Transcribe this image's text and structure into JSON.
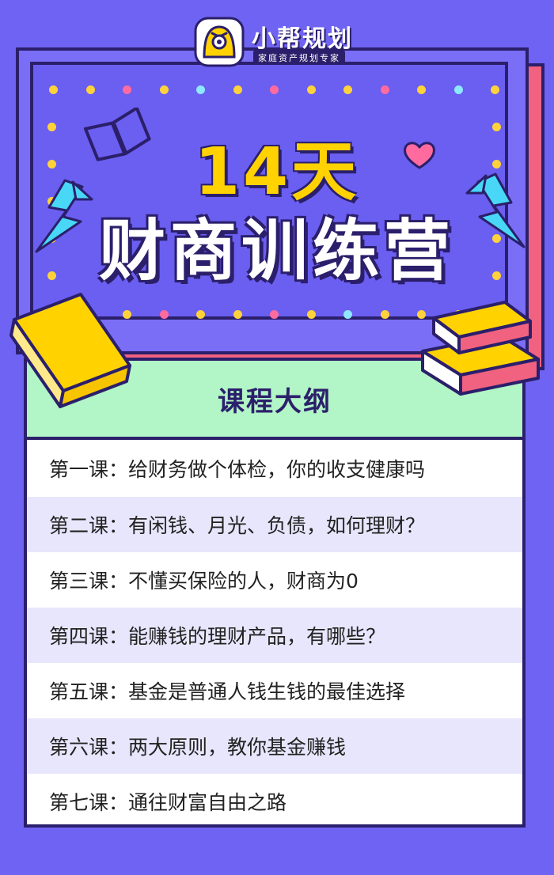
{
  "brand": {
    "name": "小帮规划",
    "tagline": "家庭资产规划专家"
  },
  "hero": {
    "days": "14天",
    "camp": "财商训练营"
  },
  "outline": {
    "title": "课程大纲",
    "lessons": [
      "第一课：给财务做个体检，你的收支健康吗",
      "第二课：有闲钱、月光、负债，如何理财？",
      "第三课：不懂买保险的人，财商为0",
      "第四课：能赚钱的理财产品，有哪些？",
      "第五课：基金是普通人钱生钱的最佳选择",
      "第六课：两大原则，教你基金赚钱",
      "第七课：通往财富自由之路"
    ]
  },
  "colors": {
    "background": "#6e63f2",
    "outline_dark": "#2b1f6b",
    "accent_yellow": "#ffd200",
    "accent_pink": "#f0627f",
    "header_green": "#b2f5c6",
    "lightning_cyan": "#48d7f7"
  },
  "icons": [
    "logo-face-icon",
    "open-book-icon",
    "heart-icon",
    "lightning-icon",
    "book-icon",
    "book-stack-icon"
  ]
}
